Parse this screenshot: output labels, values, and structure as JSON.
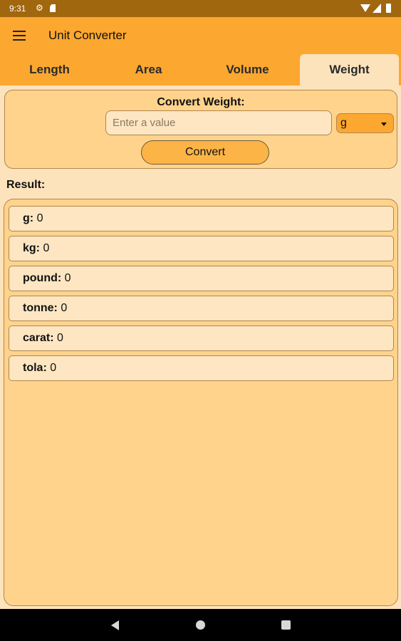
{
  "status_bar": {
    "time": "9:31",
    "icons": [
      "settings-gear-icon",
      "sd-card-icon",
      "wifi-icon",
      "cell-signal-icon",
      "battery-icon"
    ]
  },
  "app_bar": {
    "title": "Unit Converter",
    "menu_icon": "hamburger-menu-icon"
  },
  "tabs": [
    {
      "label": "Length",
      "active": false
    },
    {
      "label": "Area",
      "active": false
    },
    {
      "label": "Volume",
      "active": false
    },
    {
      "label": "Weight",
      "active": true
    }
  ],
  "converter": {
    "heading": "Convert Weight:",
    "input_value": "",
    "input_placeholder": "Enter a value",
    "unit_selected": "g",
    "button_label": "Convert"
  },
  "result": {
    "label": "Result:",
    "rows": [
      {
        "unit": "g:",
        "value": "0"
      },
      {
        "unit": "kg:",
        "value": "0"
      },
      {
        "unit": "pound:",
        "value": "0"
      },
      {
        "unit": "tonne:",
        "value": "0"
      },
      {
        "unit": "carat:",
        "value": "0"
      },
      {
        "unit": "tola:",
        "value": "0"
      }
    ]
  },
  "nav_bar": {
    "icons": [
      "back-icon",
      "home-icon",
      "recents-icon"
    ]
  },
  "colors": {
    "status_bar": "#A1670E",
    "primary": "#FCA72F",
    "background": "#FDE3BC",
    "card": "#FFD38B"
  }
}
